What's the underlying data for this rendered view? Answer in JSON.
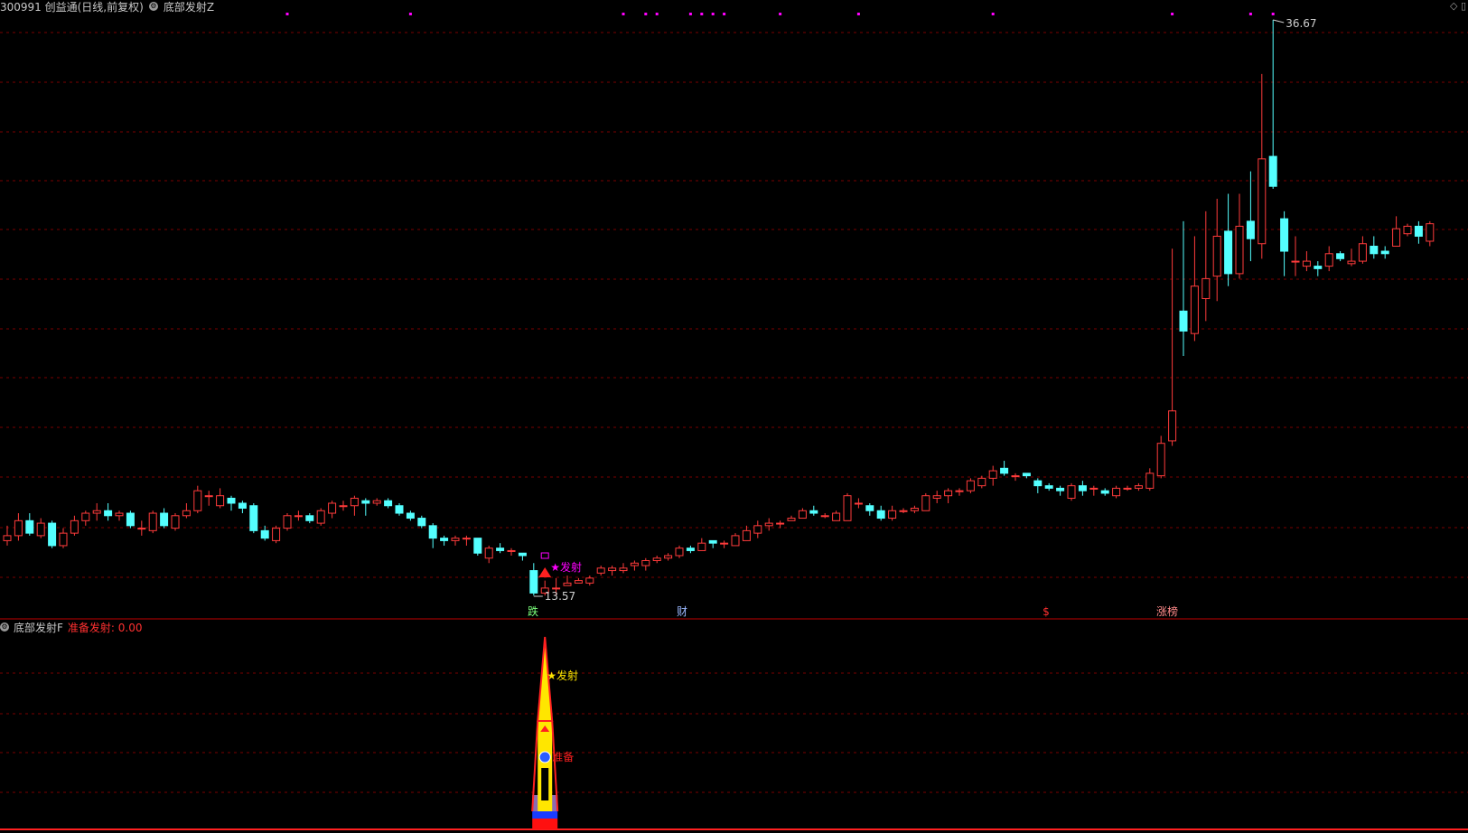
{
  "header": {
    "title": "300991 创益通(日线,前复权)",
    "indicator": "底部发射Z"
  },
  "subpanel": {
    "title": "底部发射F",
    "readout": "准备发射: 0.00"
  },
  "labels": {
    "high": "36.67",
    "low": "13.57",
    "signal": "发射",
    "signal_sub": "发射",
    "ready": "准备",
    "bottom": [
      "跌",
      "财",
      "$",
      "涨榜"
    ]
  },
  "colors": {
    "up": "#ff3b3b",
    "down": "#54ffff",
    "grid": "#7a0000",
    "marker": "#ff00ff",
    "background": "#000000"
  },
  "icons": [
    "gear-icon",
    "diamond-icon",
    "triangle-up-icon",
    "star-icon"
  ],
  "chart_data": {
    "type": "candlestick",
    "high_label": 36.67,
    "low_label": 13.57,
    "candles": [
      [
        15.8,
        16.0,
        16.4,
        15.6
      ],
      [
        16.0,
        16.6,
        16.9,
        15.8
      ],
      [
        16.6,
        16.1,
        16.9,
        16.0
      ],
      [
        16.0,
        16.5,
        16.7,
        15.9
      ],
      [
        16.5,
        15.6,
        16.6,
        15.5
      ],
      [
        15.6,
        16.1,
        16.3,
        15.5
      ],
      [
        16.1,
        16.6,
        16.8,
        16.0
      ],
      [
        16.6,
        16.9,
        17.0,
        16.4
      ],
      [
        16.9,
        17.0,
        17.3,
        16.6
      ],
      [
        17.0,
        16.8,
        17.3,
        16.6
      ],
      [
        16.8,
        16.9,
        17.0,
        16.6
      ],
      [
        16.9,
        16.4,
        17.0,
        16.3
      ],
      [
        16.3,
        16.3,
        16.6,
        16.0
      ],
      [
        16.2,
        16.9,
        17.0,
        16.1
      ],
      [
        16.9,
        16.4,
        17.1,
        16.3
      ],
      [
        16.3,
        16.8,
        16.9,
        16.2
      ],
      [
        16.8,
        17.0,
        17.3,
        16.7
      ],
      [
        17.0,
        17.8,
        18.0,
        16.9
      ],
      [
        17.6,
        17.6,
        17.8,
        17.2
      ],
      [
        17.2,
        17.6,
        17.9,
        17.1
      ],
      [
        17.5,
        17.3,
        17.6,
        17.0
      ],
      [
        17.3,
        17.1,
        17.4,
        16.9
      ],
      [
        17.2,
        16.2,
        17.3,
        16.1
      ],
      [
        16.2,
        15.9,
        16.4,
        15.8
      ],
      [
        15.8,
        16.3,
        16.4,
        15.7
      ],
      [
        16.3,
        16.8,
        16.9,
        16.2
      ],
      [
        16.8,
        16.8,
        17.0,
        16.6
      ],
      [
        16.8,
        16.6,
        16.9,
        16.5
      ],
      [
        16.5,
        17.0,
        17.1,
        16.4
      ],
      [
        16.9,
        17.3,
        17.4,
        16.7
      ],
      [
        17.2,
        17.2,
        17.4,
        17.0
      ],
      [
        17.2,
        17.5,
        17.6,
        16.8
      ],
      [
        17.4,
        17.3,
        17.5,
        16.8
      ],
      [
        17.3,
        17.4,
        17.5,
        17.2
      ],
      [
        17.4,
        17.2,
        17.5,
        17.1
      ],
      [
        17.2,
        16.9,
        17.3,
        16.8
      ],
      [
        16.9,
        16.7,
        17.0,
        16.6
      ],
      [
        16.7,
        16.4,
        16.8,
        16.3
      ],
      [
        16.4,
        15.9,
        16.5,
        15.5
      ],
      [
        15.9,
        15.8,
        16.0,
        15.6
      ],
      [
        15.8,
        15.9,
        16.0,
        15.6
      ],
      [
        15.9,
        15.9,
        16.0,
        15.6
      ],
      [
        15.9,
        15.3,
        15.9,
        15.2
      ],
      [
        15.1,
        15.5,
        15.6,
        14.9
      ],
      [
        15.5,
        15.4,
        15.7,
        15.3
      ],
      [
        15.4,
        15.4,
        15.5,
        15.2
      ],
      [
        15.3,
        15.2,
        15.3,
        15.0
      ],
      [
        14.6,
        13.7,
        14.9,
        13.6
      ],
      [
        13.7,
        13.9,
        14.2,
        13.6
      ],
      [
        13.9,
        13.9,
        14.3,
        13.6
      ],
      [
        14.0,
        14.1,
        14.4,
        14.0
      ],
      [
        14.1,
        14.2,
        14.3,
        14.1
      ],
      [
        14.1,
        14.3,
        14.4,
        14.0
      ],
      [
        14.5,
        14.7,
        14.8,
        14.4
      ],
      [
        14.6,
        14.7,
        14.8,
        14.4
      ],
      [
        14.6,
        14.7,
        14.9,
        14.5
      ],
      [
        14.8,
        14.9,
        15.0,
        14.6
      ],
      [
        14.8,
        15.0,
        15.1,
        14.6
      ],
      [
        15.0,
        15.1,
        15.2,
        14.9
      ],
      [
        15.1,
        15.2,
        15.3,
        15.0
      ],
      [
        15.2,
        15.5,
        15.6,
        15.1
      ],
      [
        15.5,
        15.4,
        15.6,
        15.3
      ],
      [
        15.4,
        15.7,
        15.9,
        15.4
      ],
      [
        15.8,
        15.7,
        15.8,
        15.5
      ],
      [
        15.7,
        15.7,
        15.8,
        15.5
      ],
      [
        15.6,
        16.0,
        16.1,
        15.6
      ],
      [
        15.8,
        16.2,
        16.4,
        15.8
      ],
      [
        16.1,
        16.4,
        16.6,
        15.9
      ],
      [
        16.4,
        16.5,
        16.7,
        16.2
      ],
      [
        16.5,
        16.5,
        16.6,
        16.3
      ],
      [
        16.6,
        16.7,
        16.8,
        16.6
      ],
      [
        16.7,
        17.0,
        17.1,
        16.7
      ],
      [
        17.0,
        16.9,
        17.2,
        16.8
      ],
      [
        16.8,
        16.8,
        16.9,
        16.7
      ],
      [
        16.6,
        16.9,
        17.0,
        16.6
      ],
      [
        16.6,
        17.6,
        17.7,
        16.6
      ],
      [
        17.3,
        17.3,
        17.5,
        17.1
      ],
      [
        17.2,
        17.0,
        17.3,
        16.8
      ],
      [
        17.0,
        16.7,
        17.2,
        16.6
      ],
      [
        16.7,
        17.0,
        17.2,
        16.6
      ],
      [
        17.0,
        17.0,
        17.1,
        16.9
      ],
      [
        17.0,
        17.1,
        17.2,
        16.9
      ],
      [
        17.0,
        17.6,
        17.7,
        17.0
      ],
      [
        17.5,
        17.6,
        17.8,
        17.3
      ],
      [
        17.6,
        17.8,
        17.9,
        17.3
      ],
      [
        17.8,
        17.8,
        17.9,
        17.6
      ],
      [
        17.8,
        18.2,
        18.3,
        17.7
      ],
      [
        18.0,
        18.3,
        18.4,
        17.9
      ],
      [
        18.3,
        18.6,
        18.8,
        18.0
      ],
      [
        18.7,
        18.5,
        19.0,
        18.4
      ],
      [
        18.4,
        18.4,
        18.5,
        18.2
      ],
      [
        18.5,
        18.4,
        18.5,
        18.3
      ],
      [
        18.2,
        18.0,
        18.3,
        17.7
      ],
      [
        18.0,
        17.9,
        18.1,
        17.8
      ],
      [
        17.9,
        17.8,
        18.0,
        17.6
      ],
      [
        17.5,
        18.0,
        18.1,
        17.4
      ],
      [
        18.0,
        17.8,
        18.2,
        17.6
      ],
      [
        17.9,
        17.9,
        18.0,
        17.6
      ],
      [
        17.8,
        17.7,
        17.9,
        17.6
      ],
      [
        17.6,
        17.9,
        18.0,
        17.5
      ],
      [
        17.9,
        17.9,
        18.0,
        17.8
      ],
      [
        17.9,
        18.0,
        18.1,
        17.8
      ],
      [
        17.9,
        18.5,
        18.7,
        17.8
      ],
      [
        18.4,
        19.7,
        20.0,
        18.3
      ],
      [
        19.8,
        21.0,
        27.5,
        19.6
      ],
      [
        25.0,
        24.2,
        28.6,
        23.2
      ],
      [
        24.1,
        26.0,
        28.0,
        23.8
      ],
      [
        25.5,
        26.3,
        29.0,
        24.6
      ],
      [
        26.4,
        28.0,
        29.5,
        25.4
      ],
      [
        28.2,
        26.5,
        29.7,
        26.0
      ],
      [
        26.5,
        28.4,
        29.7,
        26.3
      ],
      [
        28.6,
        27.9,
        30.6,
        27.0
      ],
      [
        27.7,
        31.1,
        34.5,
        27.1
      ],
      [
        31.2,
        30.0,
        36.67,
        29.9
      ],
      [
        28.7,
        27.4,
        29.0,
        26.4
      ],
      [
        27.0,
        27.0,
        28.0,
        26.4
      ],
      [
        26.8,
        27.0,
        27.4,
        26.6
      ],
      [
        26.8,
        26.7,
        27.0,
        26.4
      ],
      [
        26.8,
        27.3,
        27.6,
        26.6
      ],
      [
        27.3,
        27.1,
        27.4,
        27.0
      ],
      [
        26.9,
        27.0,
        27.5,
        26.8
      ],
      [
        27.0,
        27.7,
        28.0,
        26.9
      ],
      [
        27.6,
        27.3,
        28.0,
        27.1
      ],
      [
        27.4,
        27.3,
        27.6,
        27.1
      ],
      [
        27.6,
        28.3,
        28.8,
        27.6
      ],
      [
        28.1,
        28.4,
        28.5,
        28.0
      ],
      [
        28.4,
        28.0,
        28.6,
        27.7
      ],
      [
        27.8,
        28.5,
        28.6,
        27.6
      ]
    ],
    "signal": {
      "candle_index": 48,
      "label": "发射",
      "secondary_label": "发射"
    },
    "pink_markers": [
      25,
      36,
      55,
      57,
      58,
      61,
      62,
      63,
      64,
      69,
      76,
      88,
      104,
      111,
      113
    ]
  }
}
